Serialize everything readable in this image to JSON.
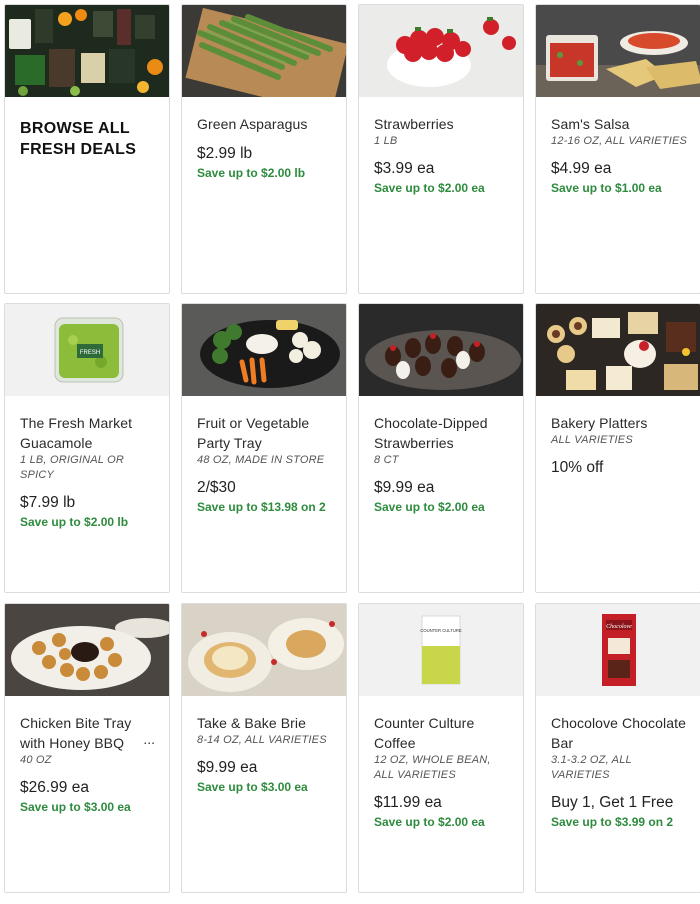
{
  "browse": {
    "title": "BROWSE ALL FRESH DEALS"
  },
  "products": [
    {
      "name": "Green Asparagus",
      "size": "",
      "price": "$2.99 lb",
      "save": "Save up to $2.00 lb"
    },
    {
      "name": "Strawberries",
      "size": "1 LB",
      "price": "$3.99 ea",
      "save": "Save up to $2.00 ea"
    },
    {
      "name": "Sam's Salsa",
      "size": "12-16 OZ, ALL VARIETIES",
      "price": "$4.99 ea",
      "save": "Save up to $1.00 ea"
    },
    {
      "name": "The Fresh Market Guacamole",
      "size": "1 LB, ORIGINAL OR SPICY",
      "price": "$7.99 lb",
      "save": "Save up to $2.00 lb"
    },
    {
      "name": "Fruit or Vegetable Party Tray",
      "size": "48 OZ, MADE IN STORE",
      "price": "2/$30",
      "save": "Save up to $13.98 on 2"
    },
    {
      "name": "Chocolate-Dipped Strawberries",
      "size": "8 CT",
      "price": "$9.99 ea",
      "save": "Save up to $2.00 ea"
    },
    {
      "name": "Bakery Platters",
      "size": "ALL VARIETIES",
      "price": "10% off",
      "save": ""
    },
    {
      "name": "Chicken Bite Tray with Honey BBQ",
      "size": "40 OZ",
      "price": "$26.99 ea",
      "save": "Save up to $3.00 ea"
    },
    {
      "name": "Take & Bake Brie",
      "size": "8-14 OZ, ALL VARIETIES",
      "price": "$9.99 ea",
      "save": "Save up to $3.00 ea"
    },
    {
      "name": "Counter Culture Coffee",
      "size": "12 OZ, WHOLE BEAN, ALL VARIETIES",
      "price": "$11.99 ea",
      "save": "Save up to $2.00 ea"
    },
    {
      "name": "Chocolove Chocolate Bar",
      "size": "3.1-3.2 OZ, ALL VARIETIES",
      "price": "Buy 1, Get 1 Free",
      "save": "Save up to $3.99 on 2"
    }
  ],
  "overflow_marker": "...",
  "packaging": {
    "guac_label": "FRESH",
    "coffee_brand": "COUNTER CULTURE",
    "choc_brand": "Chocolove"
  },
  "colors": {
    "save_green": "#2e8b3e",
    "border": "#dcdcdc"
  }
}
